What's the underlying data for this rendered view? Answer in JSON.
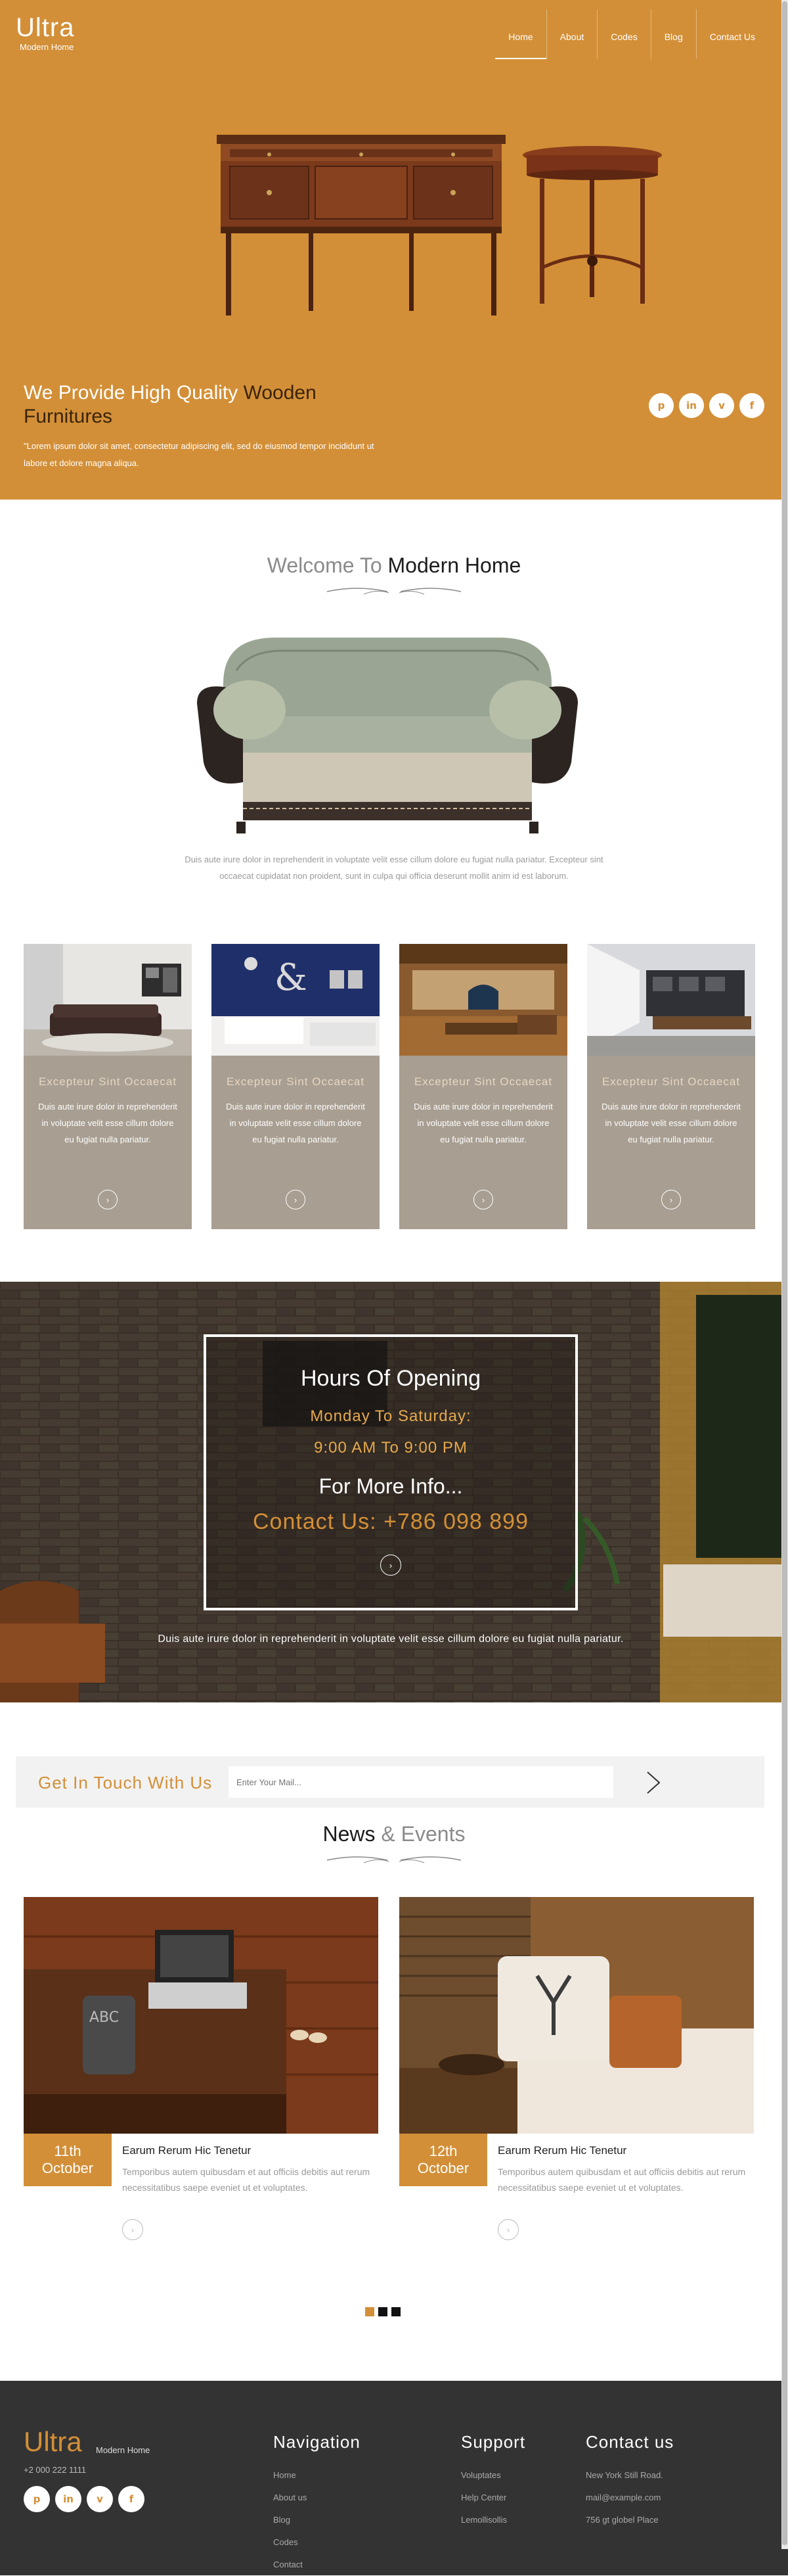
{
  "brand": {
    "logo": "Ultra",
    "tagline": "Modern Home"
  },
  "nav": {
    "items": [
      "Home",
      "About",
      "Codes",
      "Blog",
      "Contact Us"
    ]
  },
  "hero": {
    "title_light": "We Provide High Quality",
    "title_dark": "Wooden",
    "title_end": "Furnitures",
    "description": "\"Lorem ipsum dolor sit amet, consectetur adipiscing elit, sed do eiusmod tempor incididunt ut labore et dolore magna aliqua.",
    "socials": [
      "pinterest-icon",
      "linkedin-icon",
      "vimeo-icon",
      "facebook-icon"
    ]
  },
  "welcome": {
    "title_grey": "Welcome To",
    "title_dark": "Modern Home",
    "description": "Duis aute irure dolor in reprehenderit in voluptate velit esse cillum dolore eu fugiat nulla pariatur. Excepteur sint occaecat cupidatat non proident, sunt in culpa qui officia deserunt mollit anim id est laborum.",
    "cards": [
      {
        "title": "Excepteur Sint Occaecat",
        "text": "Duis aute irure dolor in reprehenderit in voluptate velit esse cillum dolore eu fugiat nulla pariatur."
      },
      {
        "title": "Excepteur Sint Occaecat",
        "text": "Duis aute irure dolor in reprehenderit in voluptate velit esse cillum dolore eu fugiat nulla pariatur."
      },
      {
        "title": "Excepteur Sint Occaecat",
        "text": "Duis aute irure dolor in reprehenderit in voluptate velit esse cillum dolore eu fugiat nulla pariatur."
      },
      {
        "title": "Excepteur Sint Occaecat",
        "text": "Duis aute irure dolor in reprehenderit in voluptate velit esse cillum dolore eu fugiat nulla pariatur."
      }
    ]
  },
  "hours": {
    "title": "Hours Of Opening",
    "days": "Monday To Saturday:",
    "time": "9:00 AM To 9:00 PM",
    "more": "For More Info...",
    "contact": "Contact Us: +786 098 899",
    "text": "Duis aute irure dolor in reprehenderit in voluptate velit esse cillum dolore eu fugiat nulla pariatur."
  },
  "newsletter": {
    "title": "Get In Touch With Us",
    "placeholder": "Enter Your Mail..."
  },
  "news": {
    "title_dark": "News",
    "title_amp": "&",
    "title_grey": "Events",
    "items": [
      {
        "day": "11th",
        "month": "October",
        "heading": "Earum Rerum Hic Tenetur",
        "text": "Temporibus autem quibusdam et aut officiis debitis aut rerum necessitatibus saepe eveniet ut et voluptates."
      },
      {
        "day": "12th",
        "month": "October",
        "heading": "Earum Rerum Hic Tenetur",
        "text": "Temporibus autem quibusdam et aut officiis debitis aut rerum necessitatibus saepe eveniet ut et voluptates."
      }
    ]
  },
  "footer": {
    "logo": "Ultra",
    "tagline": "Modern Home",
    "phone": "+2 000 222 1111",
    "nav_title": "Navigation",
    "nav_links": [
      "Home",
      "About us",
      "Blog",
      "Codes",
      "Contact"
    ],
    "support_title": "Support",
    "support_links": [
      "Voluptates",
      "Help Center",
      "Lemollisollis"
    ],
    "contact_title": "Contact us",
    "contact_lines": [
      "New York Still Road.",
      "mail@example.com",
      "756 gt globel Place"
    ]
  },
  "colors": {
    "accent": "#d38f37",
    "card": "#a89e91",
    "footer": "#333333"
  }
}
